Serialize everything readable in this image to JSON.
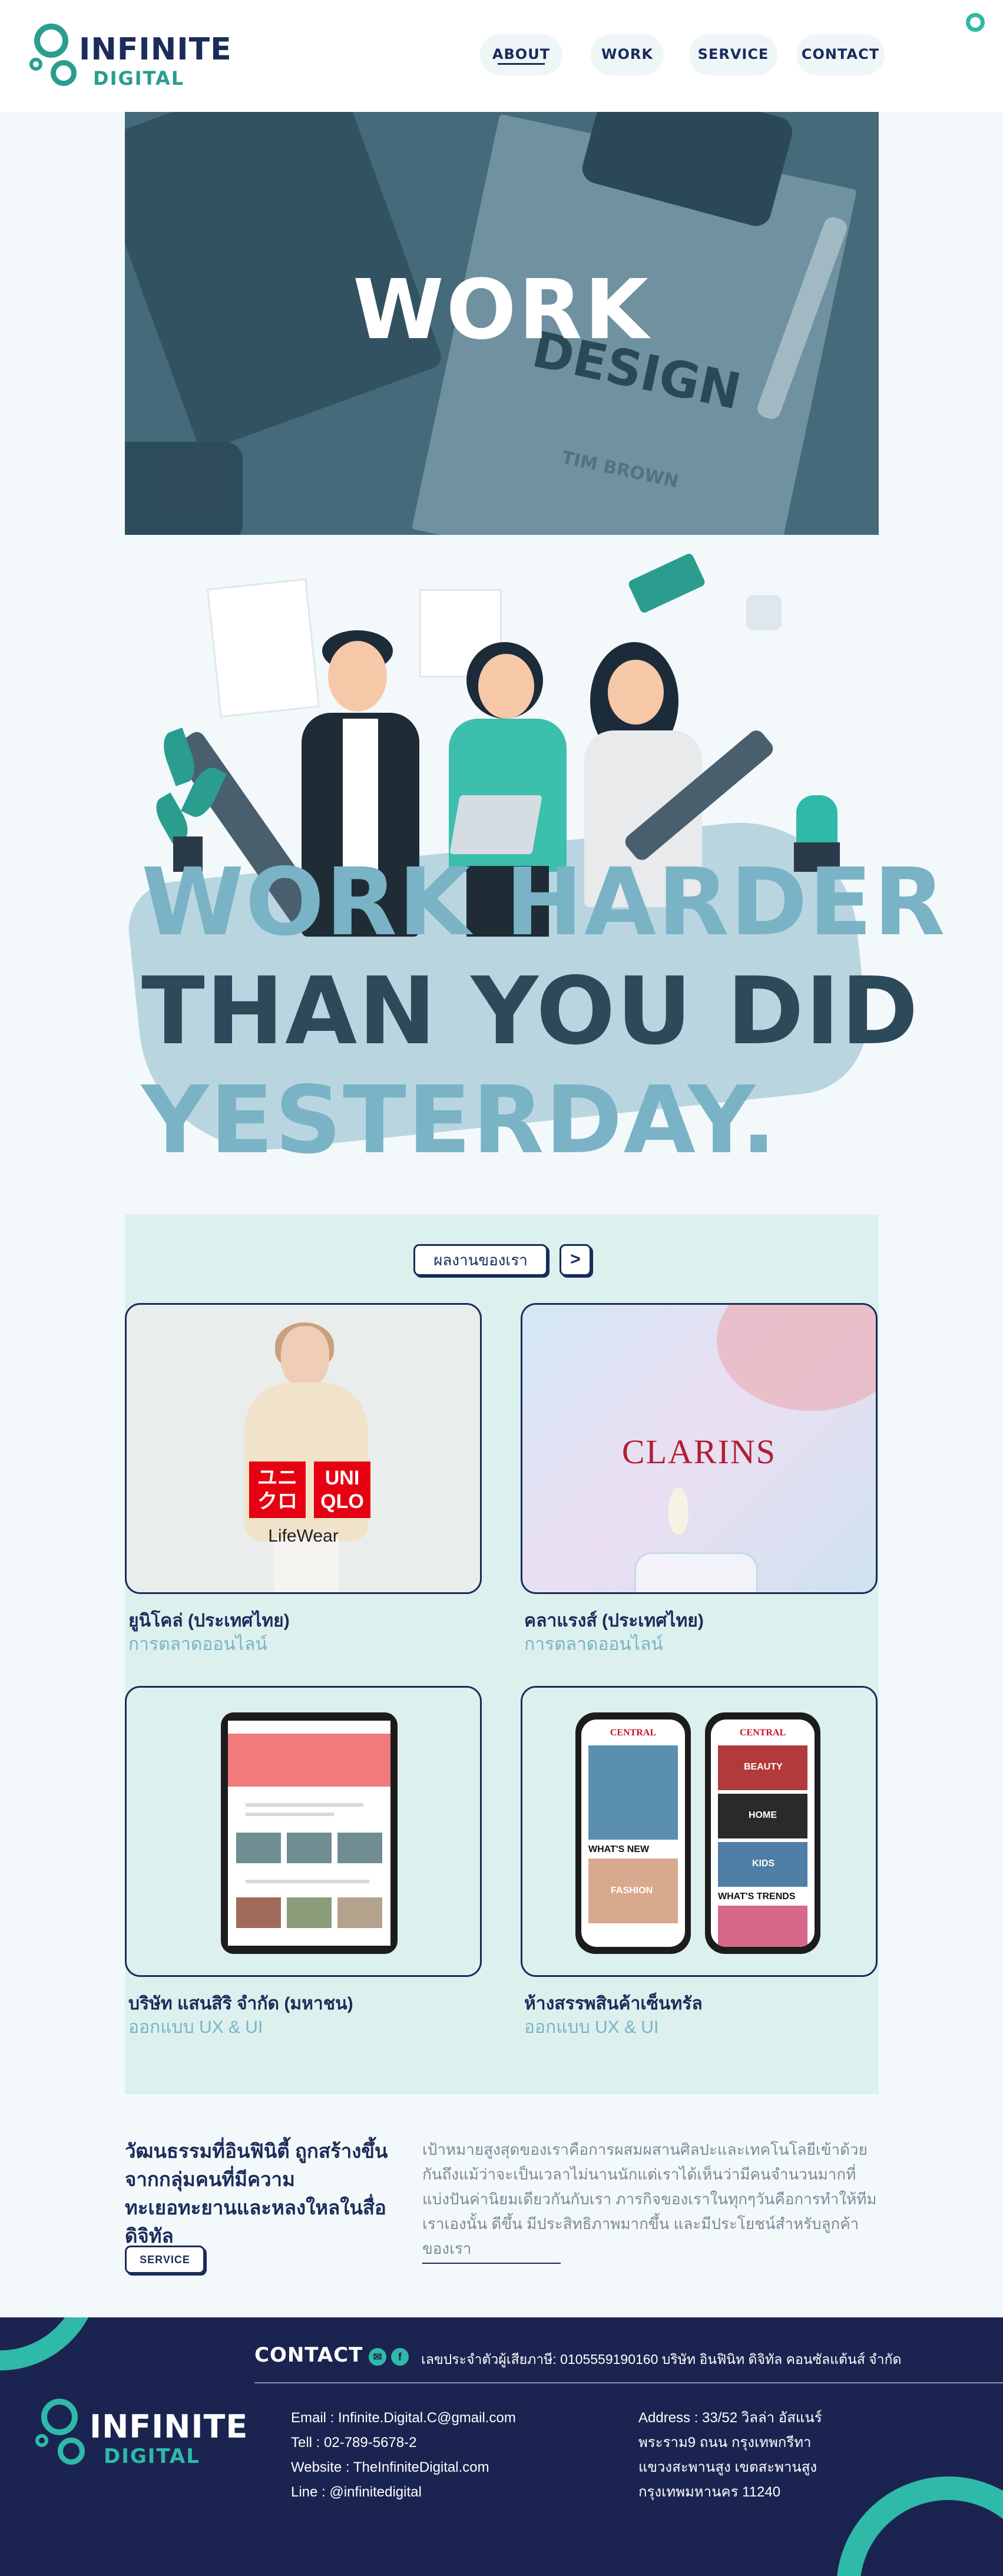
{
  "header": {
    "logo_name": "INFINITE",
    "logo_sub": "DIGITAL",
    "nav": [
      {
        "label": "ABOUT"
      },
      {
        "label": "WORK"
      },
      {
        "label": "SERVICE"
      },
      {
        "label": "CONTACT"
      }
    ],
    "active_nav": "ABOUT"
  },
  "hero": {
    "title": "WORK",
    "book_text": "DESIGN",
    "book_author": "TIM BROWN"
  },
  "slogan": {
    "line1": "WORK HARDER",
    "line2": "THAN YOU DID",
    "line3": "YESTERDAY."
  },
  "portfolio": {
    "button_label": "ผลงานของเรา",
    "arrow": ">",
    "items": [
      {
        "title": "ยูนิโคล่ (ประเทศไทย)",
        "subtitle": "การตลาดออนไลน์",
        "logo_top": "ユニ\nクロ",
        "logo_right": "UNI\nQLO",
        "caption": "LifeWear"
      },
      {
        "title": "คลาแรงส์ (ประเทศไทย)",
        "subtitle": "การตลาดออนไลน์",
        "brand": "CLARINS"
      },
      {
        "title": "บริษัท แสนสิริ จำกัด (มหาชน)",
        "subtitle": "ออกแบบ UX & UI"
      },
      {
        "title": "ห้างสรรพสินค้าเซ็นทรัล",
        "subtitle": "ออกแบบ UX & UI",
        "app_brand": "CENTRAL",
        "app_labels": [
          "BEAUTY",
          "HOME",
          "KIDS",
          "FASHION",
          "WHAT'S NEW",
          "WHAT'S TRENDS"
        ]
      }
    ]
  },
  "culture": {
    "heading": "วัฒนธรรมที่อินฟินิตี้ ถูกสร้างขึ้นจากกลุ่มคนที่มีความทะเยอทะยานและหลงใหลในสื่อดิจิทัล",
    "paragraph": "เป้าหมายสูงสุดของเราคือการผสมผสานศิลปะและเทคโนโลยีเข้าด้วยกันถึงแม้ว่าจะเป็นเวลาไม่นานนักแต่เราได้เห็นว่ามีคนจำนวนมากที่แบ่งปันค่านิยมเดียวกันกับเรา  ภารกิจของเราในทุกๆวันคือการทำให้ทีมเราเองนั้น ดีขึ้น มีประสิทธิภาพมากขึ้น และมีประโยชน์สำหรับลูกค้าของเรา",
    "button_label": "SERVICE"
  },
  "footer": {
    "contact_label": "CONTACT",
    "tax_line": "เลขประจำตัวผู้เสียภาษี: 0105559190160 บริษัท อินฟินิท ดิจิทัล คอนซัลแต้นส์ จำกัด",
    "logo_name": "INFINITE",
    "logo_sub": "DIGITAL",
    "email": "Email : Infinite.Digital.C@gmail.com",
    "tel": "Tell : 02-789-5678-2",
    "website": "Website : TheInfiniteDigital.com",
    "line": "Line : @infinitedigital",
    "address1": "Address : 33/52 วิลล่า อัสแนร์",
    "address2": "พระราม9 ถนน กรุงเทพกรีทา",
    "address3": "แขวงสะพานสูง เขตสะพานสูง",
    "address4": "กรุงเทพมหานคร 11240"
  },
  "colors": {
    "navy": "#1b2b5a",
    "teal": "#2a9d8f",
    "light_blue": "#7ab3c6",
    "mint": "#dcf1ee",
    "footer_bg": "#1b2450"
  }
}
